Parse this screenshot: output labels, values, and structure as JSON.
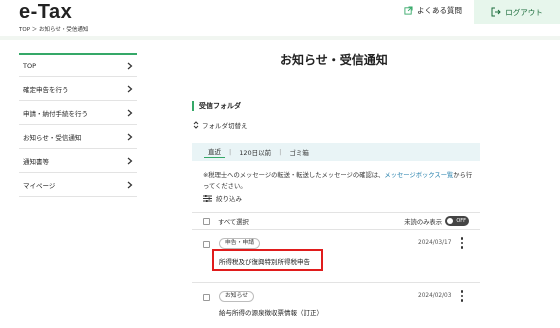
{
  "header": {
    "logo": "e-Tax",
    "faq": "よくある質問",
    "logout": "ログアウト"
  },
  "breadcrumb": "TOP ＞ お知らせ・受信通知",
  "sidebar": {
    "items": [
      {
        "label": "TOP"
      },
      {
        "label": "確定申告を行う"
      },
      {
        "label": "申請・納付手続を行う"
      },
      {
        "label": "お知らせ・受信通知"
      },
      {
        "label": "通知書等"
      },
      {
        "label": "マイページ"
      }
    ]
  },
  "main": {
    "title": "お知らせ・受信通知",
    "folder_heading": "受信フォルダ",
    "folder_switch": "フォルダ切替え",
    "tabs": [
      {
        "label": "直近",
        "active": true
      },
      {
        "label": "120日以前",
        "active": false
      },
      {
        "label": "ゴミ箱",
        "active": false
      }
    ],
    "notice_before": "※税理士へのメッセージの転送・転送したメッセージの確認は、",
    "notice_link": "メッセージボックスー覧",
    "notice_after": "から行ってください。",
    "narrow": "絞り込み",
    "select_all": "すべて選択",
    "unread_label": "未読のみ表示",
    "toggle_state": "OFF",
    "messages": [
      {
        "category": "申告・申請",
        "date": "2024/03/17",
        "subject": "所得税及び復興特別所得税申告",
        "highlighted": true
      },
      {
        "category": "お知らせ",
        "date": "2024/02/03",
        "subject": "給与所得の源泉徴収票情報（訂正）",
        "highlighted": false
      }
    ]
  },
  "colors": {
    "accent": "#35a868",
    "link": "#1a7aa8",
    "highlight_box": "#e01c1c",
    "tab_bar_bg": "#e9f4f6",
    "logout_bg": "#e7f6ec"
  },
  "icons": [
    "external-link-icon",
    "logout-icon",
    "chevron-right-icon",
    "folder-switch-icon",
    "filter-icon",
    "kebab-menu-icon"
  ]
}
